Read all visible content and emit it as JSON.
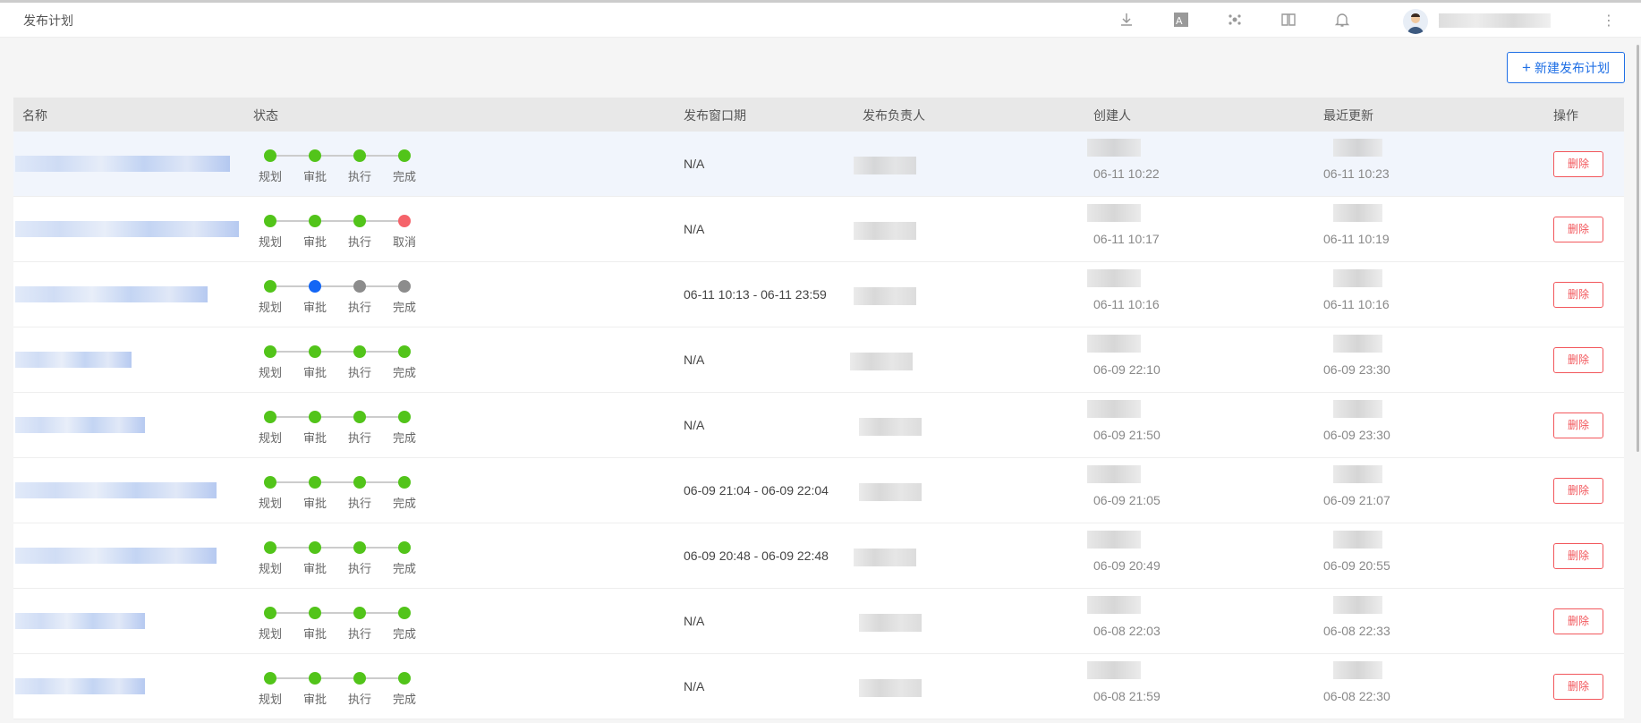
{
  "header": {
    "title": "发布计划",
    "icons": [
      "download-icon",
      "translate-icon",
      "dots-cluster-icon",
      "book-icon",
      "bell-icon"
    ],
    "more_icon": "⋮"
  },
  "toolbar": {
    "new_label": "新建发布计划"
  },
  "table": {
    "columns": [
      "名称",
      "状态",
      "发布窗口期",
      "发布负责人",
      "创建人",
      "最近更新",
      "操作"
    ],
    "step_labels": [
      "规划",
      "审批",
      "执行"
    ],
    "rows": [
      {
        "final_label": "完成",
        "states": [
          "done",
          "done",
          "done",
          "done"
        ],
        "window": "N/A",
        "created": "06-11 10:22",
        "updated": "06-11 10:23",
        "action": "删除"
      },
      {
        "final_label": "取消",
        "states": [
          "done",
          "done",
          "done",
          "cancel"
        ],
        "window": "N/A",
        "created": "06-11 10:17",
        "updated": "06-11 10:19",
        "action": "删除"
      },
      {
        "final_label": "完成",
        "states": [
          "done",
          "active",
          "pending",
          "pending"
        ],
        "window": "06-11 10:13 - 06-11 23:59",
        "created": "06-11 10:16",
        "updated": "06-11 10:16",
        "action": "删除"
      },
      {
        "final_label": "完成",
        "states": [
          "done",
          "done",
          "done",
          "done"
        ],
        "window": "N/A",
        "created": "06-09 22:10",
        "updated": "06-09 23:30",
        "action": "删除"
      },
      {
        "final_label": "完成",
        "states": [
          "done",
          "done",
          "done",
          "done"
        ],
        "window": "N/A",
        "created": "06-09 21:50",
        "updated": "06-09 23:30",
        "action": "删除"
      },
      {
        "final_label": "完成",
        "states": [
          "done",
          "done",
          "done",
          "done"
        ],
        "window": "06-09 21:04 - 06-09 22:04",
        "created": "06-09 21:05",
        "updated": "06-09 21:07",
        "action": "删除"
      },
      {
        "final_label": "完成",
        "states": [
          "done",
          "done",
          "done",
          "done"
        ],
        "window": "06-09 20:48 - 06-09 22:48",
        "created": "06-09 20:49",
        "updated": "06-09 20:55",
        "action": "删除"
      },
      {
        "final_label": "完成",
        "states": [
          "done",
          "done",
          "done",
          "done"
        ],
        "window": "N/A",
        "created": "06-08 22:03",
        "updated": "06-08 22:33",
        "action": "删除"
      },
      {
        "final_label": "完成",
        "states": [
          "done",
          "done",
          "done",
          "done"
        ],
        "window": "N/A",
        "created": "06-08 21:59",
        "updated": "06-08 22:30",
        "action": "删除"
      }
    ]
  },
  "colors": {
    "done": "#52c41a",
    "cancel": "#f5636a",
    "active": "#1366f5",
    "pending": "#8c8c8c",
    "primary": "#1f6fe5",
    "danger": "#f2575c"
  }
}
